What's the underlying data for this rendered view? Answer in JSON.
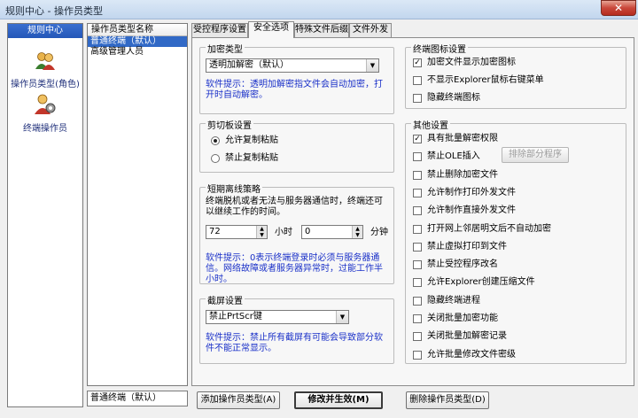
{
  "window": {
    "title": "规则中心 - 操作员类型",
    "close": "✕"
  },
  "sidebar": {
    "header": "规则中心",
    "items": [
      {
        "label": "操作员类型(角色)",
        "icon": "users-icon"
      },
      {
        "label": "终端操作员",
        "icon": "user-gear-icon"
      }
    ]
  },
  "list": {
    "column": "操作员类型名称",
    "rows": [
      "普通终端（默认）",
      "高级管理人员"
    ],
    "selected_index": 0
  },
  "name_input": "普通终端（默认）",
  "tabs": [
    "受控程序设置",
    "安全选项",
    "特殊文件后缀",
    "文件外发"
  ],
  "active_tab": 1,
  "encrypt": {
    "title": "加密类型",
    "value": "透明加解密（默认）",
    "hint": "软件提示：透明加解密指文件会自动加密，打开时自动解密。"
  },
  "clipboard": {
    "title": "剪切板设置",
    "options": [
      "允许复制粘贴",
      "禁止复制粘贴"
    ],
    "selected": 0
  },
  "offline": {
    "title": "短期离线策略",
    "desc": "终端脱机或者无法与服务器通信时，终端还可以继续工作的时间。",
    "hours": "72",
    "hours_unit": "小时",
    "minutes": "0",
    "minutes_unit": "分钟",
    "hint": "软件提示：0表示终端登录时必须与服务器通信。网络故障或者服务器异常时，过能工作半小时。"
  },
  "screenshot": {
    "title": "截屏设置",
    "value": "禁止PrtScr键",
    "hint": "软件提示：禁止所有截屏有可能会导致部分软件不能正常显示。"
  },
  "tray": {
    "title": "终端图标设置",
    "items": [
      {
        "label": "加密文件显示加密图标",
        "checked": true
      },
      {
        "label": "不显示Explorer鼠标右键菜单",
        "checked": false
      },
      {
        "label": "隐藏终端图标",
        "checked": false
      }
    ]
  },
  "other": {
    "title": "其他设置",
    "items": [
      {
        "label": "具有批量解密权限",
        "checked": true
      },
      {
        "label": "禁止OLE插入",
        "checked": false
      },
      {
        "label": "禁止删除加密文件",
        "checked": false
      },
      {
        "label": "允许制作打印外发文件",
        "checked": false
      },
      {
        "label": "允许制作直接外发文件",
        "checked": false
      },
      {
        "label": "打开网上邻居明文后不自动加密",
        "checked": false
      },
      {
        "label": "禁止虚拟打印到文件",
        "checked": false
      },
      {
        "label": "禁止受控程序改名",
        "checked": false
      },
      {
        "label": "允许Explorer创建压缩文件",
        "checked": false
      },
      {
        "label": "隐藏终端进程",
        "checked": false
      },
      {
        "label": "关闭批量加密功能",
        "checked": false
      },
      {
        "label": "关闭批量加解密记录",
        "checked": false
      },
      {
        "label": "允许批量修改文件密级",
        "checked": false
      }
    ],
    "exclude_button": "排除部分程序"
  },
  "buttons": {
    "add": "添加操作员类型(A)",
    "apply": "修改并生效(M)",
    "delete": "删除操作员类型(D)"
  }
}
